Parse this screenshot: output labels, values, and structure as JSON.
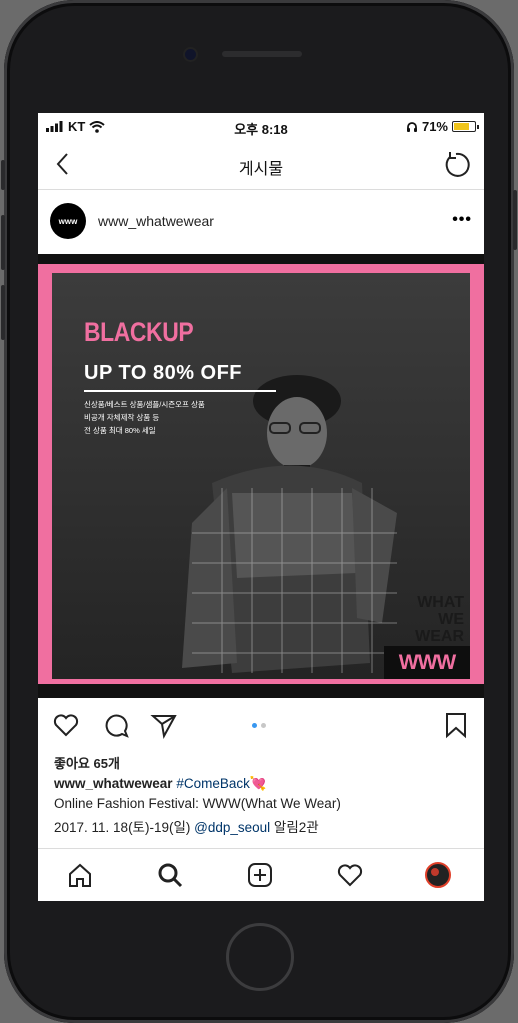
{
  "status_bar": {
    "carrier": "KT",
    "time": "오후 8:18",
    "battery": "71%",
    "battery_level": 0.71
  },
  "nav": {
    "title": "게시물",
    "back_icon": "chevron-left-icon",
    "refresh_icon": "refresh-icon"
  },
  "post": {
    "username": "www_whatwewear",
    "avatar_text": "www",
    "more_icon": "ellipsis-icon",
    "image": {
      "brand": "BLACKUP",
      "headline": "UP TO 80% OFF",
      "lines": [
        "신상품/베스트 상품/샘플/시즌오프 상품",
        "비공개 자체제작 상품 등",
        "전 상품 최대 80% 세일"
      ],
      "logo_lines": [
        "WHAT",
        "WE",
        "WEAR"
      ],
      "badge": "WWW",
      "accent_color": "#f06fa0"
    },
    "carousel": {
      "count": 2,
      "active": 1
    },
    "likes": "좋아요 65개",
    "caption": {
      "user": "www_whatwewear",
      "hashtag": "#ComeBack",
      "emoji": "💘",
      "line2": "Online Fashion Festival: WWW(What We Wear)",
      "line3_prefix": "2017. 11. 18(토)-19(일) ",
      "mention": "@ddp_seoul",
      "line3_suffix": " 알림2관"
    }
  },
  "tabbar": [
    "home-icon",
    "search-icon",
    "add-icon",
    "heart-icon",
    "profile-avatar"
  ]
}
